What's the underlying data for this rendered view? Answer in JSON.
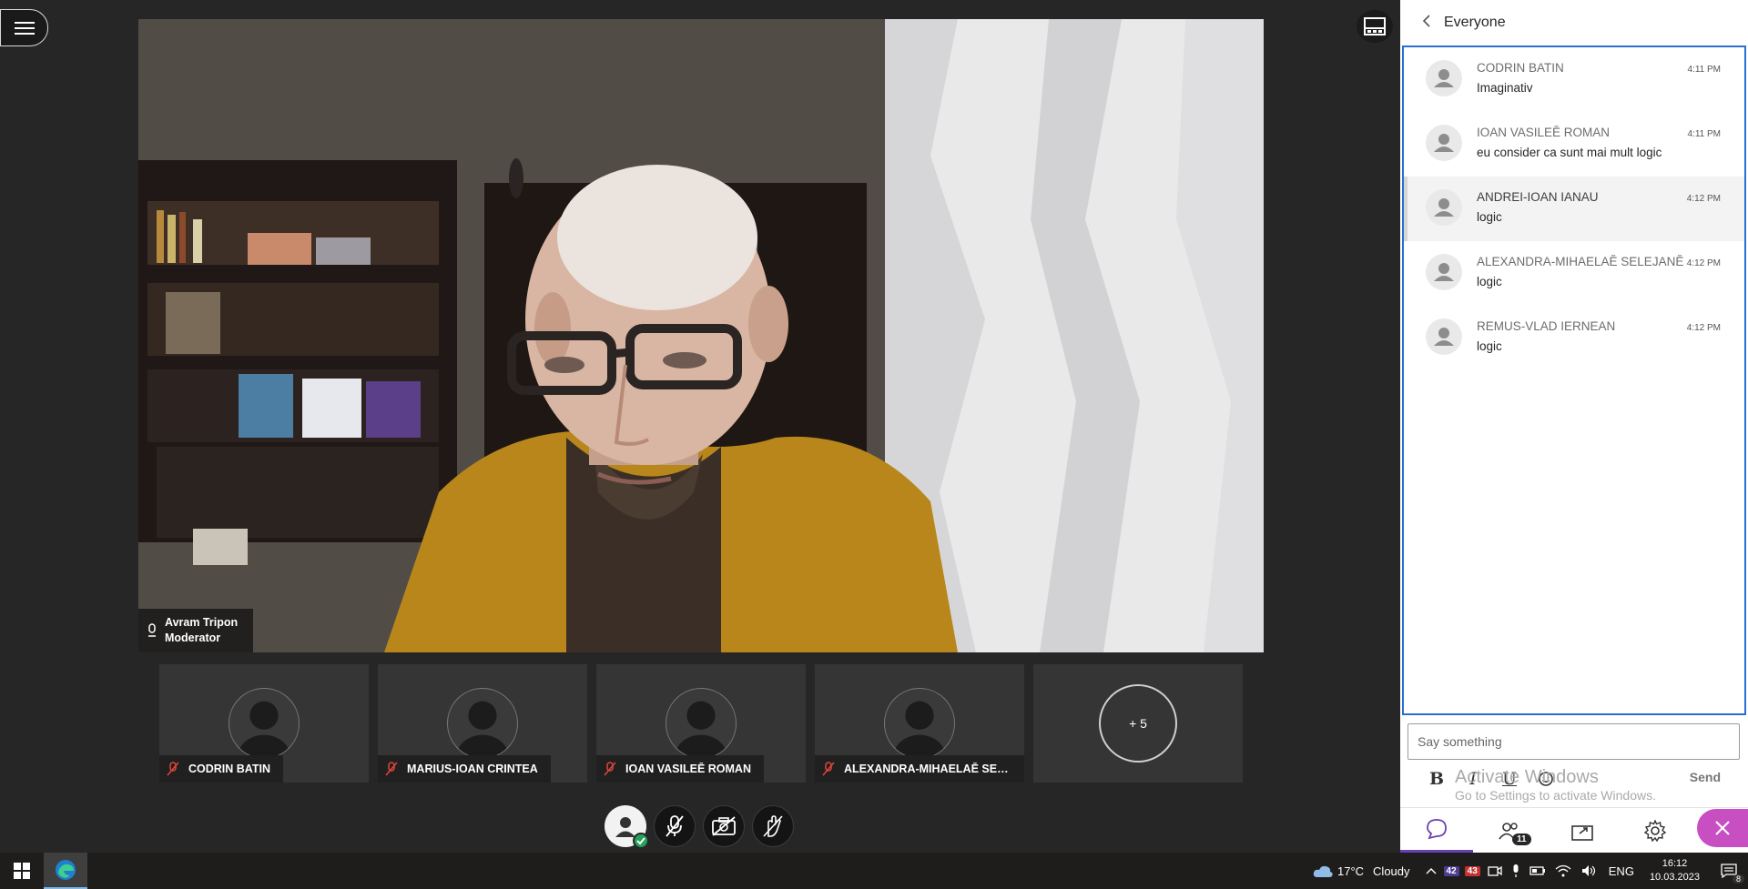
{
  "menu": {
    "icon": "hamburger-menu-icon"
  },
  "video": {
    "speaker_name": "Avram Tripon",
    "speaker_role": "Moderator"
  },
  "participants": [
    {
      "name": "CODRIN BATIN"
    },
    {
      "name": "MARIUS-IOAN CRINTEA"
    },
    {
      "name": "IOAN VASILEĔ ROMAN"
    },
    {
      "name": "ALEXANDRA-MIHAELAĔ SELEJ..."
    }
  ],
  "more_participants": "+ 5",
  "chat": {
    "title": "Everyone",
    "messages": [
      {
        "author": "CODRIN BATIN",
        "time": "4:11 PM",
        "text": "Imaginativ"
      },
      {
        "author": "IOAN VASILEĔ ROMAN",
        "time": "4:11 PM",
        "text": "eu consider ca sunt mai mult logic"
      },
      {
        "author": "ANDREI-IOAN IANAU",
        "time": "4:12 PM",
        "text": "logic"
      },
      {
        "author": "ALEXANDRA-MIHAELAĔ SELEJANĔ",
        "time": "4:12 PM",
        "text": "logic"
      },
      {
        "author": "REMUS-VLAD IERNEAN",
        "time": "4:12 PM",
        "text": "logic"
      }
    ],
    "input_placeholder": "Say something",
    "format": {
      "bold": "B",
      "italic": "I",
      "underline": "U"
    },
    "send_label": "Send",
    "watermark_title": "Activate Windows",
    "watermark_sub": "Go to Settings to activate Windows.",
    "participants_badge": "11"
  },
  "colors": {
    "accent_purple": "#6c3fb0",
    "close_pink": "#c84fc2",
    "focus_blue": "#2a6ed1",
    "status_green": "#23a15a"
  },
  "taskbar": {
    "weather_temp": "17°C",
    "weather_desc": "Cloudy",
    "badge_a": "42",
    "badge_b": "43",
    "language": "ENG",
    "time": "16:12",
    "date": "10.03.2023",
    "notifications": "8"
  }
}
